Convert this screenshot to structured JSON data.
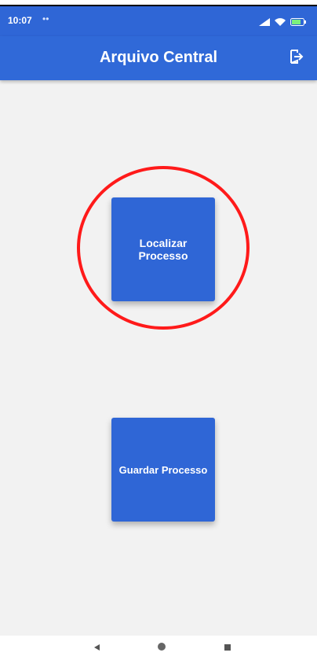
{
  "status_bar": {
    "time": "10:07",
    "dots": "••"
  },
  "app_bar": {
    "title": "Arquivo Central",
    "logout_icon": "logout-icon"
  },
  "tiles": [
    {
      "label": "Localizar Processo"
    },
    {
      "label": "Guardar Processo"
    }
  ],
  "colors": {
    "primary": "#3069d8",
    "tile": "#2f66d6",
    "background": "#f2f2f2",
    "highlight": "#ff1a1a"
  },
  "nav_bar": {
    "icons": [
      "back-icon",
      "home-icon",
      "recents-icon"
    ]
  }
}
